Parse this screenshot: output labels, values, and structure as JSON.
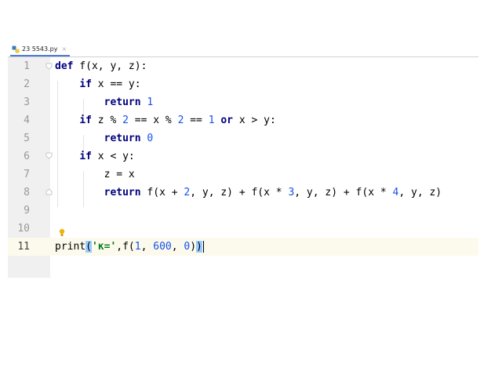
{
  "tab": {
    "title": "23  5543.py",
    "close_glyph": "×",
    "icon": "python-file-icon"
  },
  "line_numbers": [
    "1",
    "2",
    "3",
    "4",
    "5",
    "6",
    "7",
    "8",
    "9",
    "10",
    "11"
  ],
  "code": [
    [
      {
        "t": "def",
        "c": "kw"
      },
      {
        "t": " f(x, y, z):"
      }
    ],
    [
      {
        "t": "    "
      },
      {
        "t": "if",
        "c": "kw"
      },
      {
        "t": " x == y:"
      }
    ],
    [
      {
        "t": "        "
      },
      {
        "t": "return",
        "c": "kw"
      },
      {
        "t": " "
      },
      {
        "t": "1",
        "c": "num"
      }
    ],
    [
      {
        "t": "    "
      },
      {
        "t": "if",
        "c": "kw"
      },
      {
        "t": " z % "
      },
      {
        "t": "2",
        "c": "num"
      },
      {
        "t": " == x % "
      },
      {
        "t": "2",
        "c": "num"
      },
      {
        "t": " == "
      },
      {
        "t": "1",
        "c": "num"
      },
      {
        "t": " "
      },
      {
        "t": "or",
        "c": "kw"
      },
      {
        "t": " x > y:"
      }
    ],
    [
      {
        "t": "        "
      },
      {
        "t": "return",
        "c": "kw"
      },
      {
        "t": " "
      },
      {
        "t": "0",
        "c": "num"
      }
    ],
    [
      {
        "t": "    "
      },
      {
        "t": "if",
        "c": "kw"
      },
      {
        "t": " x < y:"
      }
    ],
    [
      {
        "t": "        z = x"
      }
    ],
    [
      {
        "t": "        "
      },
      {
        "t": "return",
        "c": "kw"
      },
      {
        "t": " f(x + "
      },
      {
        "t": "2",
        "c": "num"
      },
      {
        "t": ", y, z) + f(x * "
      },
      {
        "t": "3",
        "c": "num"
      },
      {
        "t": ", y, z) + f(x * "
      },
      {
        "t": "4",
        "c": "num"
      },
      {
        "t": ", y, z)"
      }
    ],
    [],
    [],
    [
      {
        "t": "print"
      },
      {
        "t": "(",
        "c": "bracket-hl"
      },
      {
        "t": "'к='",
        "c": "str"
      },
      {
        "t": ",f("
      },
      {
        "t": "1",
        "c": "num"
      },
      {
        "t": ", "
      },
      {
        "t": "600",
        "c": "num"
      },
      {
        "t": ", "
      },
      {
        "t": "0",
        "c": "num"
      },
      {
        "t": ")"
      },
      {
        "t": ")",
        "c": "bracket-hl"
      }
    ]
  ],
  "current_line": 11,
  "colors": {
    "keyword": "#000080",
    "number": "#1750eb",
    "string": "#067d17",
    "current_line_bg": "#fcfaed",
    "bracket_highlight": "#99ccff"
  }
}
